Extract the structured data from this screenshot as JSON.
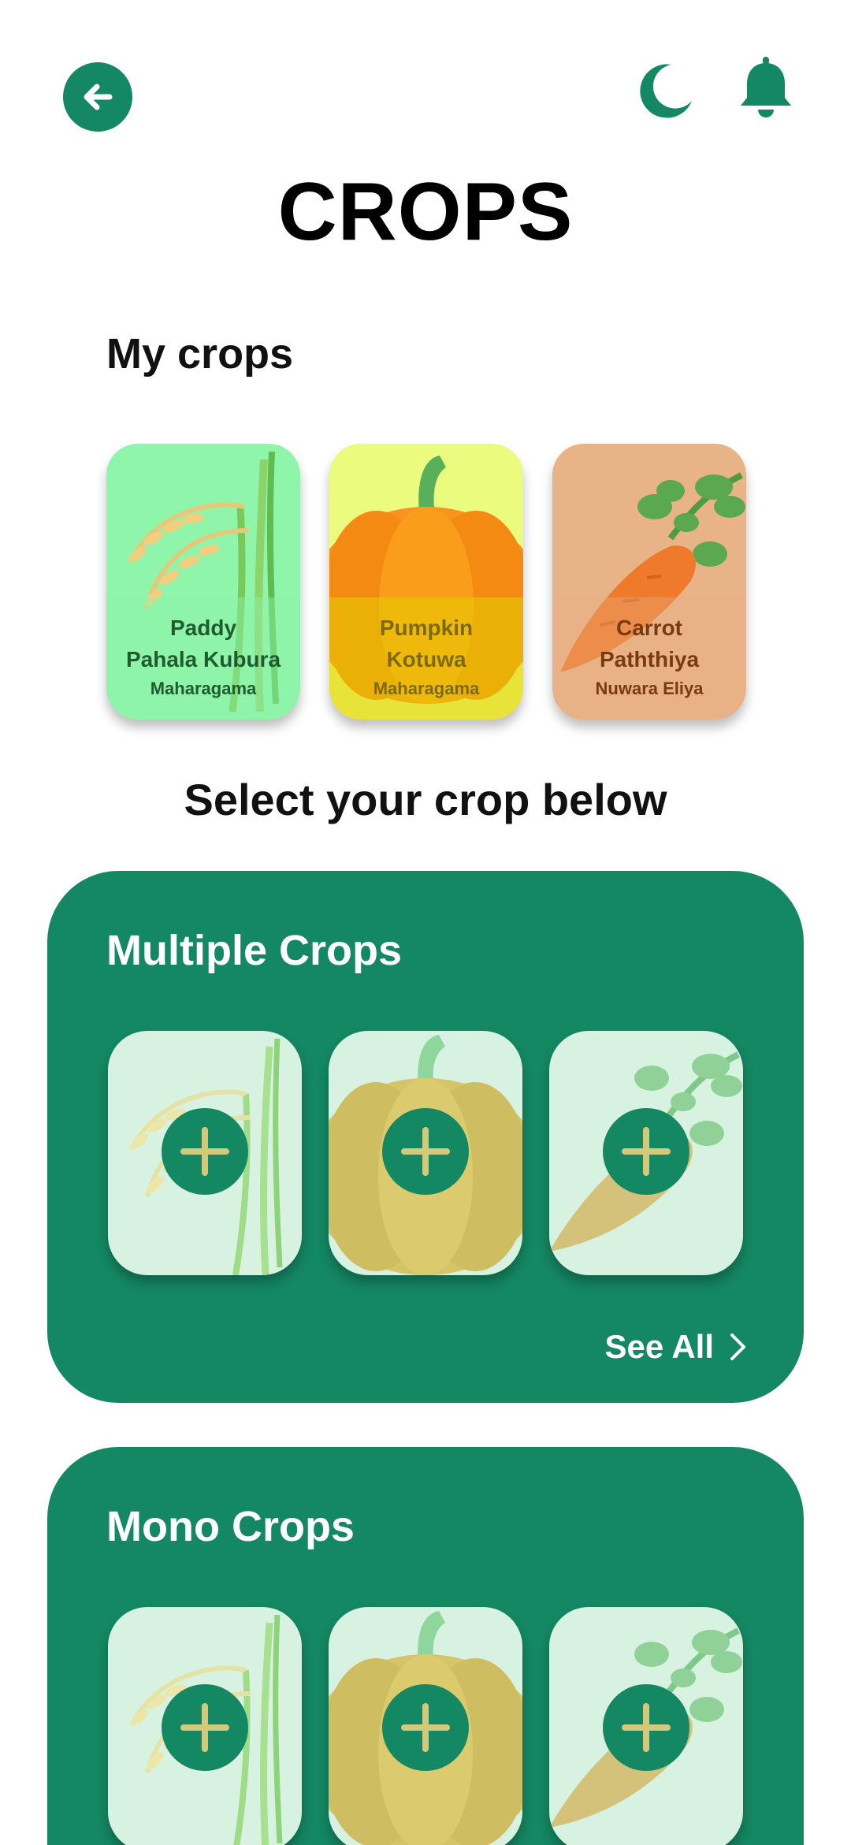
{
  "header": {
    "back_icon": "arrow-left-icon",
    "theme_icon": "moon-icon",
    "notification_icon": "bell-icon",
    "title": "CROPS"
  },
  "my_crops": {
    "heading": "My crops",
    "items": [
      {
        "name": "Paddy",
        "variety": "Pahala Kubura",
        "location": "Maharagama",
        "bg": "#8ef5aa",
        "text_color": "#1f5b2e"
      },
      {
        "name": "Pumpkin",
        "variety": "Kotuwa",
        "location": "Maharagama",
        "bg": "#ebfb7e",
        "text_color": "#7d6a10"
      },
      {
        "name": "Carrot",
        "variety": "Paththiya",
        "location": "Nuwara Eliya",
        "bg": "#e8b386",
        "text_color": "#7a3a10"
      }
    ]
  },
  "select_prompt": "Select your crop below",
  "sections": [
    {
      "title": "Multiple Crops",
      "see_all": "See All",
      "tiles": [
        "paddy",
        "pumpkin",
        "carrot"
      ]
    },
    {
      "title": "Mono Crops",
      "tiles": [
        "paddy",
        "pumpkin",
        "carrot"
      ]
    }
  ],
  "colors": {
    "accent": "#148763",
    "tile_bg": "#d8f2e1"
  }
}
